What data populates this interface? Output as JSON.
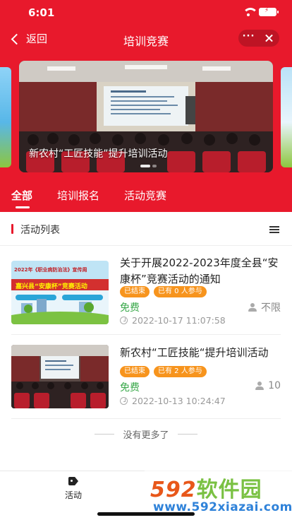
{
  "status_bar": {
    "time": "6:01"
  },
  "nav": {
    "back_label": "返回",
    "title": "培训竞赛",
    "more": "···"
  },
  "banner": {
    "caption": "新农村“工匠技能”提升培训活动"
  },
  "tabs": [
    {
      "label": "全部",
      "active": true
    },
    {
      "label": "培训报名",
      "active": false
    },
    {
      "label": "活动竞赛",
      "active": false
    }
  ],
  "section": {
    "title": "活动列表"
  },
  "activities": [
    {
      "title": "关于开展2022-2023年度全县“安康杯”竞赛活动的通知",
      "status_badge": "已结束",
      "participants_badge": "已有 0 人参与",
      "price": "免费",
      "quota": "不限",
      "datetime": "2022-10-17 11:07:58",
      "thumb_text": "2022年《职业病防治法》宣传周",
      "thumb_banner": "嘉兴县“安康杯”竞赛活动"
    },
    {
      "title": "新农村“工匠技能“提升培训活动",
      "status_badge": "已结束",
      "participants_badge": "已有 2 人参与",
      "price": "免费",
      "quota": "10",
      "datetime": "2022-10-13 10:24:47"
    }
  ],
  "list_footer": "没有更多了",
  "bottom_nav": {
    "activity_label": "活动"
  },
  "watermark": {
    "brand_num": "592",
    "brand_cn": "软件园",
    "url": "www.592xiazai.com"
  },
  "colors": {
    "primary": "#e8192c",
    "badge": "#f7941d",
    "price": "#3aa94b"
  }
}
